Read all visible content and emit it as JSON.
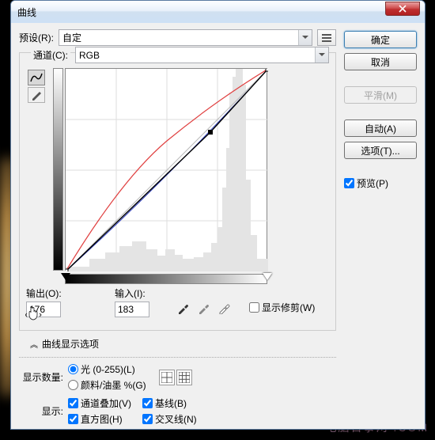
{
  "window": {
    "title": "曲线"
  },
  "preset": {
    "label": "预设(R):",
    "value": "自定"
  },
  "channel": {
    "label": "通道(C):",
    "value": "RGB"
  },
  "output": {
    "label": "输出(O):",
    "value": "176"
  },
  "input": {
    "label": "输入(I):",
    "value": "183"
  },
  "clip": {
    "label": "显示修剪(W)"
  },
  "expand": {
    "label": "曲线显示选项"
  },
  "display_amount": {
    "label": "显示数量:",
    "opt_light": "光 (0-255)(L)",
    "opt_ink": "颜料/油墨 %(G)"
  },
  "show": {
    "label": "显示:",
    "overlay": "通道叠加(V)",
    "baseline": "基线(B)",
    "histogram": "直方图(H)",
    "intersection": "交叉线(N)"
  },
  "buttons": {
    "ok": "确定",
    "cancel": "取消",
    "smooth": "平滑(M)",
    "auto": "自动(A)",
    "options": "选项(T)...",
    "preview": "预览(P)"
  },
  "watermark": "电脑百事网 .COM",
  "chart_data": {
    "type": "line",
    "title": "曲线",
    "xlabel": "输入",
    "ylabel": "输出",
    "xlim": [
      0,
      255
    ],
    "ylim": [
      0,
      255
    ],
    "series": [
      {
        "name": "baseline",
        "x": [
          0,
          255
        ],
        "y": [
          0,
          255
        ],
        "color": "#888"
      },
      {
        "name": "RGB",
        "x": [
          0,
          183,
          255
        ],
        "y": [
          0,
          176,
          255
        ],
        "color": "#000"
      },
      {
        "name": "red-channel",
        "x": [
          0,
          60,
          128,
          200,
          255
        ],
        "y": [
          0,
          90,
          165,
          228,
          255
        ],
        "color": "#e04040"
      },
      {
        "name": "blue-channel",
        "x": [
          0,
          128,
          255
        ],
        "y": [
          0,
          118,
          255
        ],
        "color": "#3040c0"
      }
    ],
    "active_point": {
      "x": 183,
      "y": 176
    }
  }
}
